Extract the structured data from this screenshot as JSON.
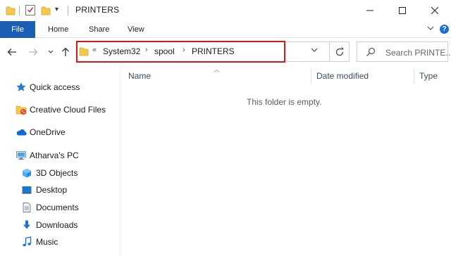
{
  "window": {
    "title": "PRINTERS",
    "qat_dropdown": "▾"
  },
  "ribbon": {
    "tabs": [
      "File",
      "Home",
      "Share",
      "View"
    ]
  },
  "address": {
    "overflow": "«",
    "crumbs": [
      "System32",
      "spool",
      "PRINTERS"
    ],
    "separator": "›"
  },
  "search": {
    "placeholder": "Search PRINTE..."
  },
  "sidebar": {
    "items": [
      {
        "label": "Quick access",
        "icon": "star-icon"
      },
      {
        "label": "Creative Cloud Files",
        "icon": "creative-cloud-folder-icon"
      },
      {
        "label": "OneDrive",
        "icon": "cloud-icon"
      },
      {
        "label": "Atharva's PC",
        "icon": "computer-icon"
      },
      {
        "label": "3D Objects",
        "icon": "cube-icon"
      },
      {
        "label": "Desktop",
        "icon": "desktop-icon"
      },
      {
        "label": "Documents",
        "icon": "document-icon"
      },
      {
        "label": "Downloads",
        "icon": "download-arrow-icon"
      },
      {
        "label": "Music",
        "icon": "music-note-icon"
      }
    ]
  },
  "columns": {
    "name": "Name",
    "date_modified": "Date modified",
    "type": "Type"
  },
  "content": {
    "empty_message": "This folder is empty."
  },
  "colors": {
    "accent": "#1a5fb4",
    "highlight": "#d11a1a",
    "folder": "#f2c94c"
  }
}
